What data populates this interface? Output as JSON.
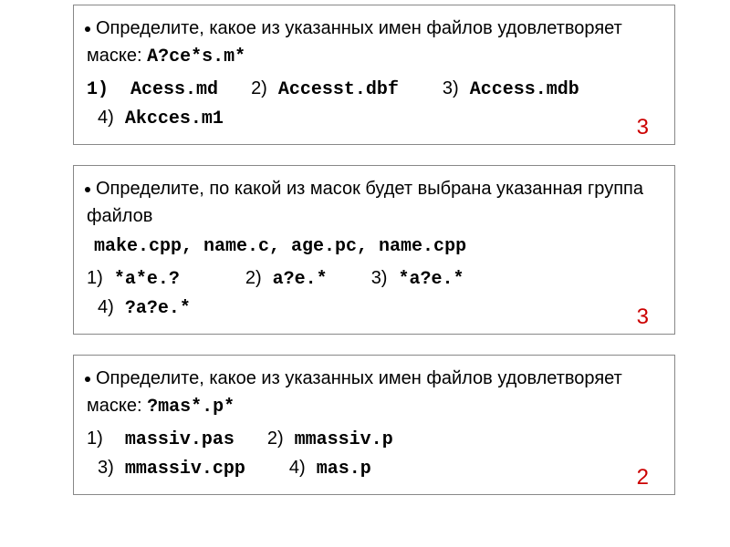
{
  "problems": [
    {
      "question_pre": "Определите, какое из указанных имен файлов удовлетворяет маске:",
      "mask": "A?ce*s.m*",
      "options": {
        "o1": "Acess.md",
        "o2": "Accesst.dbf",
        "o3": "Access.mdb",
        "o4": "Akcces.m1"
      },
      "answer": "3"
    },
    {
      "question_pre": "Определите, по какой из масок будет выбрана указанная группа файлов",
      "files": "make.cpp, name.c, age.pc, name.cpp",
      "options": {
        "o1": "*a*e.?",
        "o2": "a?e.*",
        "o3": "*a?e.*",
        "o4": "?a?e.*"
      },
      "answer": "3"
    },
    {
      "question_pre": "Определите, какое из указанных имен файлов удовлетворяет маске:",
      "mask": "?mas*.p*",
      "options": {
        "o1": "massiv.pas",
        "o2": "mmassiv.p",
        "o3": "mmassiv.cpp",
        "o4": "mas.p"
      },
      "answer": "2"
    }
  ],
  "labels": {
    "n1": "1)",
    "n2": "2)",
    "n3": "3)",
    "n4": "4)"
  }
}
